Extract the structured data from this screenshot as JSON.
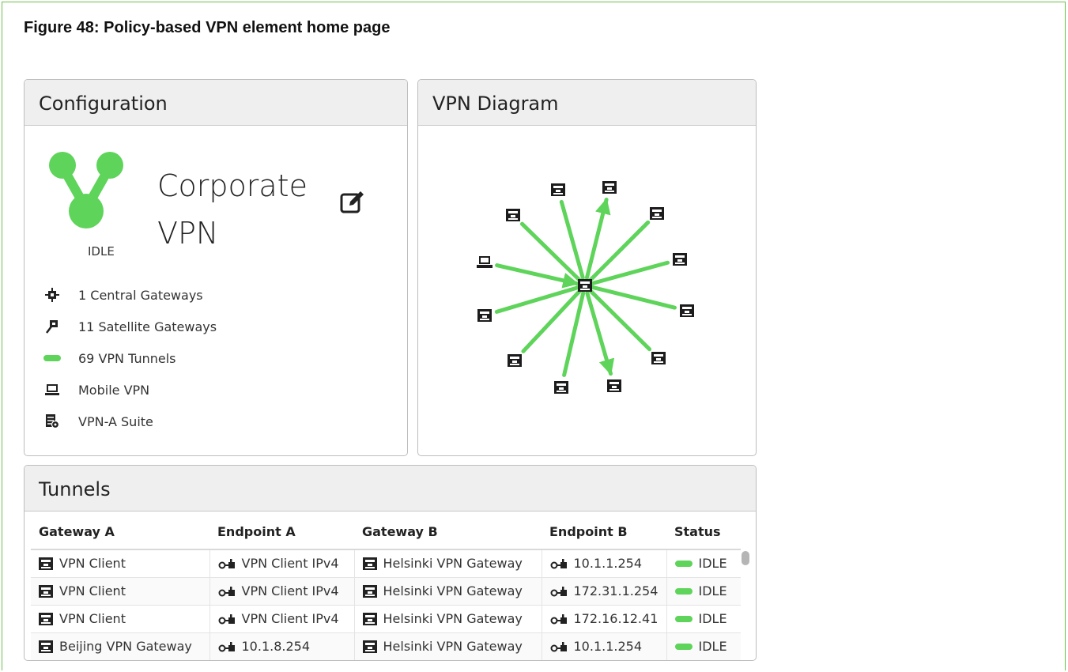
{
  "figure": {
    "title": "Figure 48: Policy-based VPN element home page"
  },
  "colors": {
    "accent_green": "#5ed45a",
    "frame_green": "#6cc04a",
    "header_bg": "#efefef"
  },
  "configuration": {
    "heading": "Configuration",
    "vpn_name_line1": "Corporate",
    "vpn_name_line2": "VPN",
    "state": "IDLE",
    "edit_icon": "edit-icon",
    "items": [
      {
        "icon": "central-gateway-icon",
        "label": "1 Central Gateways"
      },
      {
        "icon": "satellite-gateway-icon",
        "label": "11 Satellite Gateways"
      },
      {
        "icon": "vpn-tunnel-icon",
        "label": "69 VPN Tunnels"
      },
      {
        "icon": "laptop-icon",
        "label": "Mobile VPN"
      },
      {
        "icon": "vpn-suite-icon",
        "label": "VPN-A Suite"
      }
    ]
  },
  "diagram": {
    "heading": "VPN Diagram",
    "central_node": "central-gateway-node",
    "satellite_count": 11,
    "mobile_client": "laptop-icon"
  },
  "tunnels": {
    "heading": "Tunnels",
    "columns": [
      "Gateway A",
      "Endpoint A",
      "Gateway B",
      "Endpoint B",
      "Status"
    ],
    "rows": [
      {
        "gateway_a": "VPN Client",
        "endpoint_a": "VPN Client IPv4",
        "gateway_b": "Helsinki VPN Gateway",
        "endpoint_b": "10.1.1.254",
        "status": "IDLE"
      },
      {
        "gateway_a": "VPN Client",
        "endpoint_a": "VPN Client IPv4",
        "gateway_b": "Helsinki VPN Gateway",
        "endpoint_b": "172.31.1.254",
        "status": "IDLE"
      },
      {
        "gateway_a": "VPN Client",
        "endpoint_a": "VPN Client IPv4",
        "gateway_b": "Helsinki VPN Gateway",
        "endpoint_b": "172.16.12.41",
        "status": "IDLE"
      },
      {
        "gateway_a": "Beijing VPN Gateway",
        "endpoint_a": "10.1.8.254",
        "gateway_b": "Helsinki VPN Gateway",
        "endpoint_b": "10.1.1.254",
        "status": "IDLE"
      }
    ]
  }
}
